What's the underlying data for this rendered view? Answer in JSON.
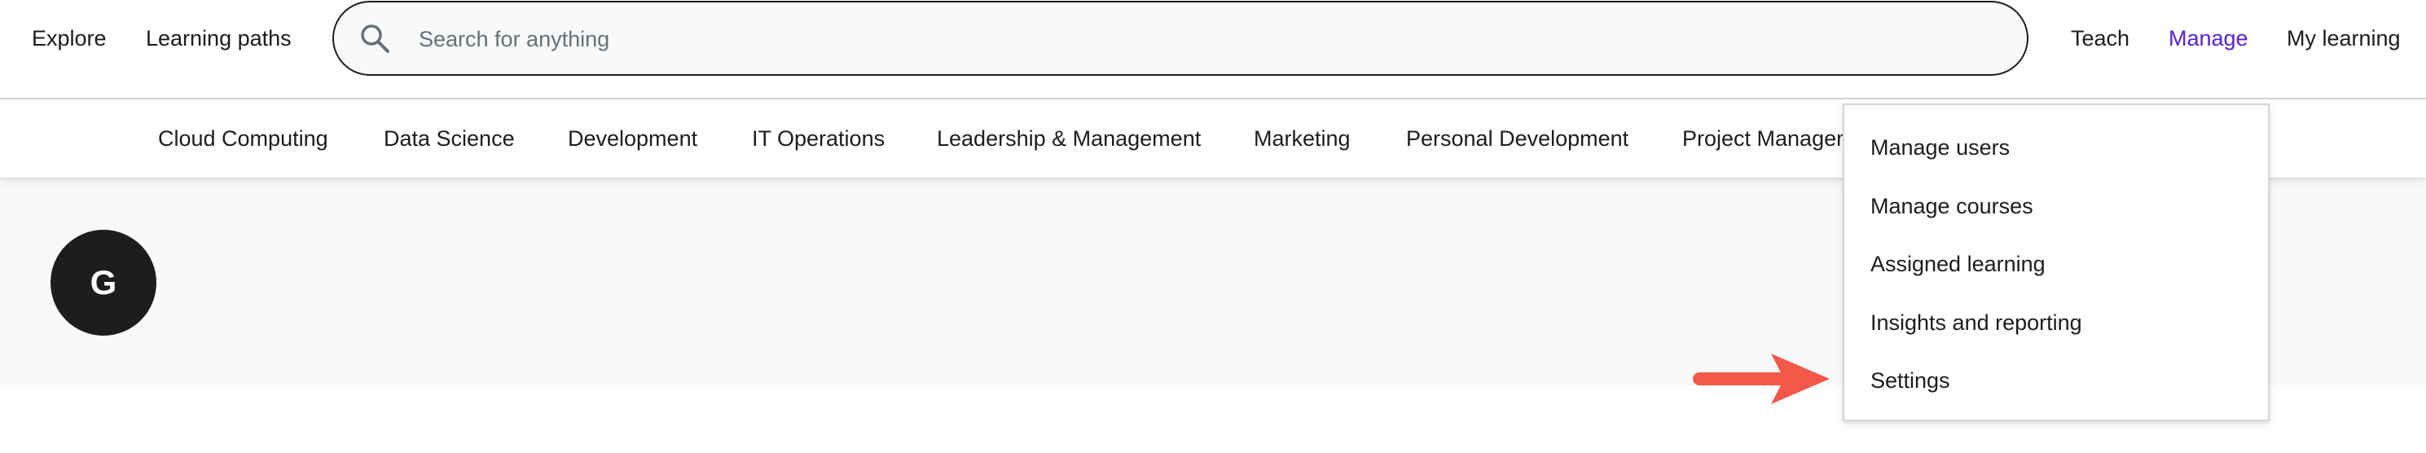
{
  "header": {
    "explore_label": "Explore",
    "learning_paths_label": "Learning paths",
    "search": {
      "placeholder": "Search for anything",
      "value": ""
    },
    "teach_label": "Teach",
    "manage_label": "Manage",
    "my_learning_label": "My learning"
  },
  "categories": [
    "Cloud Computing",
    "Data Science",
    "Development",
    "IT Operations",
    "Leadership & Management",
    "Marketing",
    "Personal Development",
    "Project Management"
  ],
  "avatar": {
    "initial": "G"
  },
  "manage_menu": {
    "items": [
      "Manage users",
      "Manage courses",
      "Assigned learning",
      "Insights and reporting",
      "Settings"
    ]
  },
  "colors": {
    "accent": "#5624d0",
    "text": "#1c1d1f",
    "arrow": "#f2584a",
    "hero_bg": "#f7f9fa"
  },
  "icons": {
    "search": "search-icon",
    "annotation": "red-arrow-icon"
  }
}
